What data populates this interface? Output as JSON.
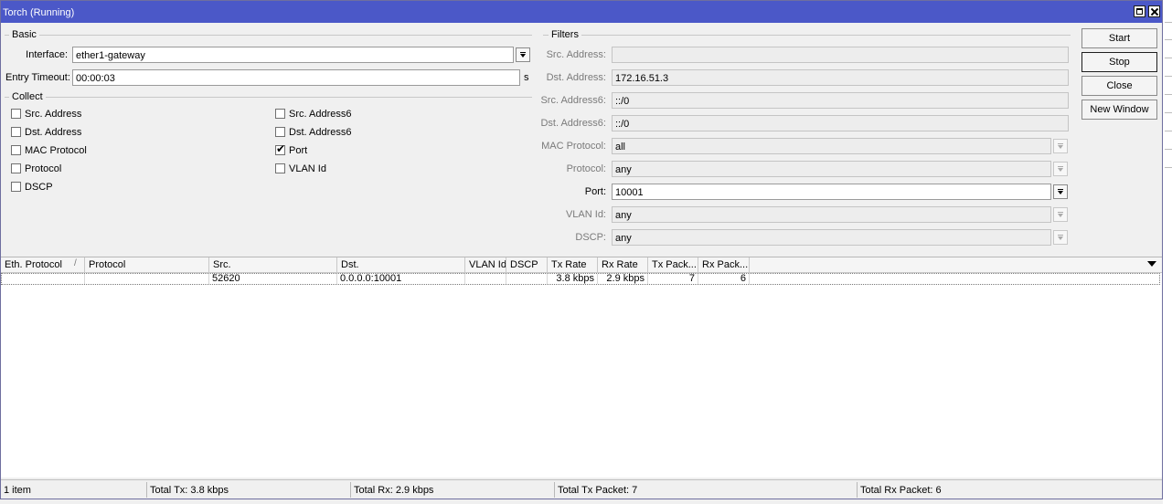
{
  "window": {
    "title": "Torch (Running)"
  },
  "basic": {
    "group_title": "Basic",
    "interface_label": "Interface:",
    "interface_value": "ether1-gateway",
    "timeout_label": "Entry Timeout:",
    "timeout_value": "00:00:03",
    "timeout_unit": "s"
  },
  "collect": {
    "group_title": "Collect",
    "items": [
      {
        "label": "Src. Address",
        "checked": false
      },
      {
        "label": "Dst. Address",
        "checked": false
      },
      {
        "label": "MAC Protocol",
        "checked": false
      },
      {
        "label": "Protocol",
        "checked": false
      },
      {
        "label": "DSCP",
        "checked": false
      },
      {
        "label": "Src. Address6",
        "checked": false
      },
      {
        "label": "Dst. Address6",
        "checked": false
      },
      {
        "label": "Port",
        "checked": true
      },
      {
        "label": "VLAN Id",
        "checked": false
      }
    ]
  },
  "filters": {
    "group_title": "Filters",
    "src_address_label": "Src. Address:",
    "src_address_value": "",
    "dst_address_label": "Dst. Address:",
    "dst_address_value": "172.16.51.3",
    "src_address6_label": "Src. Address6:",
    "src_address6_value": "::/0",
    "dst_address6_label": "Dst. Address6:",
    "dst_address6_value": "::/0",
    "mac_protocol_label": "MAC Protocol:",
    "mac_protocol_value": "all",
    "protocol_label": "Protocol:",
    "protocol_value": "any",
    "port_label": "Port:",
    "port_value": "10001",
    "vlan_label": "VLAN Id:",
    "vlan_value": "any",
    "dscp_label": "DSCP:",
    "dscp_value": "any"
  },
  "buttons": {
    "start": "Start",
    "stop": "Stop",
    "close": "Close",
    "new_window": "New Window"
  },
  "table": {
    "columns": [
      "Eth. Protocol",
      "Protocol",
      "Src.",
      "Dst.",
      "VLAN Id",
      "DSCP",
      "Tx Rate",
      "Rx Rate",
      "Tx Pack...",
      "Rx Pack..."
    ],
    "sort_indicator": "/",
    "rows": [
      {
        "eth_protocol": "",
        "protocol": "",
        "src": "52620",
        "dst": "0.0.0.0:10001",
        "vlan_id": "",
        "dscp": "",
        "tx_rate": "3.8 kbps",
        "rx_rate": "2.9 kbps",
        "tx_packets": "7",
        "rx_packets": "6"
      }
    ]
  },
  "status": {
    "items": "1 item",
    "total_tx": "Total Tx: 3.8 kbps",
    "total_rx": "Total Rx: 2.9 kbps",
    "total_tx_packet": "Total Tx Packet: 7",
    "total_rx_packet": "Total Rx Packet: 6"
  },
  "colors": {
    "titlebar": "#4b58c8",
    "window_bg": "#f0f0f0"
  }
}
